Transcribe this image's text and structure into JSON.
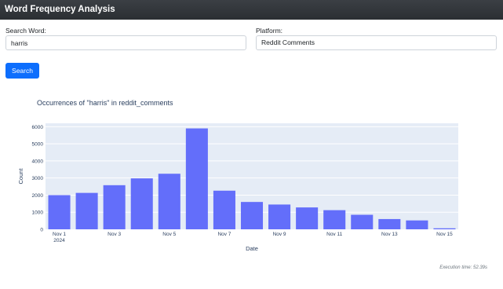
{
  "app": {
    "title": "Word Frequency Analysis"
  },
  "form": {
    "search_label": "Search Word:",
    "search_value": "harris",
    "platform_label": "Platform:",
    "platform_value": "Reddit Comments",
    "search_button": "Search"
  },
  "footer": {
    "execution_time": "Execution time: 52.39s"
  },
  "colors": {
    "bar": "#636efa",
    "plot_bg": "#e5ecf6",
    "button": "#0d6efd"
  },
  "chart_data": {
    "type": "bar",
    "title": "Occurrences of \"harris\" in reddit_comments",
    "xlabel": "Date",
    "ylabel": "Count",
    "ylim": [
      0,
      6200
    ],
    "yticks": [
      0,
      1000,
      2000,
      3000,
      4000,
      5000,
      6000
    ],
    "grid": true,
    "x": [
      "2024-11-01",
      "2024-11-02",
      "2024-11-03",
      "2024-11-04",
      "2024-11-05",
      "2024-11-06",
      "2024-11-07",
      "2024-11-08",
      "2024-11-09",
      "2024-11-10",
      "2024-11-11",
      "2024-11-12",
      "2024-11-13",
      "2024-11-14",
      "2024-11-15"
    ],
    "values": [
      2000,
      2130,
      2580,
      2980,
      3250,
      5900,
      2260,
      1600,
      1450,
      1280,
      1120,
      850,
      600,
      520,
      60
    ],
    "xtick_labels": [
      {
        "index": 0,
        "label": "Nov 1",
        "sublabel": "2024"
      },
      {
        "index": 2,
        "label": "Nov 3"
      },
      {
        "index": 4,
        "label": "Nov 5"
      },
      {
        "index": 6,
        "label": "Nov 7"
      },
      {
        "index": 8,
        "label": "Nov 9"
      },
      {
        "index": 10,
        "label": "Nov 11"
      },
      {
        "index": 12,
        "label": "Nov 13"
      },
      {
        "index": 14,
        "label": "Nov 15"
      }
    ]
  }
}
